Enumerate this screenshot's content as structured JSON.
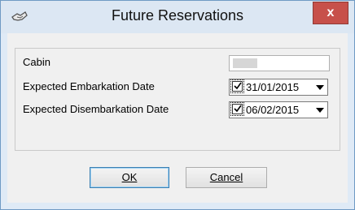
{
  "window": {
    "title": "Future Reservations",
    "app_icon": "handshake-icon",
    "close_label": "x"
  },
  "form": {
    "cabin_label": "Cabin",
    "cabin_value": "",
    "embark_label": "Expected Embarkation Date",
    "embark_checked": true,
    "embark_date": "31/01/2015",
    "disembark_label": "Expected Disembarkation Date",
    "disembark_checked": true,
    "disembark_date": "06/02/2015"
  },
  "buttons": {
    "ok_label": "OK",
    "cancel_label": "Cancel"
  },
  "colors": {
    "close_button": "#c7504a",
    "title_bar": "#dce7f3",
    "dialog_background": "#f0f0f0"
  }
}
